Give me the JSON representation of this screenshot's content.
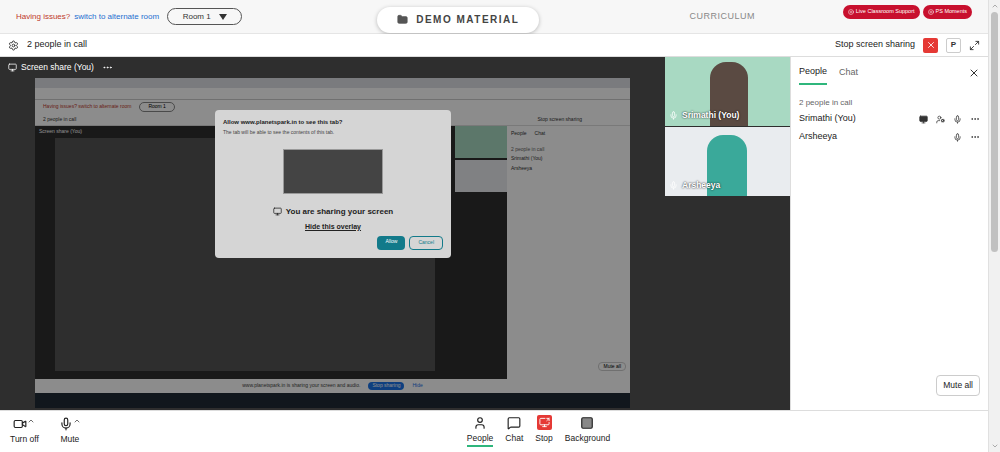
{
  "top_bar": {
    "issue_text": "Having issues?",
    "switch_link": "switch to alternate room",
    "room_select": "Room 1",
    "tabs": [
      {
        "label": "DEMO MATERIAL",
        "selected": true
      },
      {
        "label": "CURRICULUM",
        "selected": false
      }
    ],
    "buttons": [
      "Live Classroom Support",
      "PS Moments"
    ]
  },
  "call_bar": {
    "count": "2 people in call",
    "stop_label": "Stop screen sharing",
    "presenter_badge": "P"
  },
  "screen_share": {
    "label": "Screen share (You)",
    "shared": {
      "dialog_title": "Allow www.planetspark.in to see this tab?",
      "dialog_text": "The tab will be able to see the contents of this tab.",
      "sharing_text": "You are sharing your screen",
      "hide_overlay": "Hide this overlay",
      "allow": "Allow",
      "cancel": "Cancel",
      "issue_text": "Having issues? switch to alternate room",
      "room_select": "Room 1",
      "count": "2 people in call",
      "label": "Screen share (You)",
      "stop_label": "Stop screen sharing",
      "participants": [
        "Srimathi (You)",
        "Arsheeya"
      ],
      "panel_tabs": [
        "People",
        "Chat"
      ],
      "mute_all": "Mute all",
      "share_bar": "www.planetspark.in is sharing your screen and audio.",
      "stop_sharing": "Stop sharing",
      "hide": "Hide"
    }
  },
  "videos": [
    {
      "name": "Srimathi (You)",
      "color": "#a8d9c2"
    },
    {
      "name": "Arsheeya",
      "color": "#e9ecef"
    }
  ],
  "side_panel": {
    "tabs": [
      {
        "label": "People",
        "selected": true
      },
      {
        "label": "Chat",
        "selected": false
      }
    ],
    "count": "2 people in call",
    "participants": [
      {
        "name": "Srimathi (You)",
        "presenting": true
      },
      {
        "name": "Arsheeya",
        "presenting": false
      }
    ],
    "mute_all": "Mute all"
  },
  "toolbar": {
    "left": [
      {
        "label": "Turn off",
        "kind": "video"
      },
      {
        "label": "Mute",
        "kind": "mic"
      }
    ],
    "center": [
      {
        "label": "People",
        "kind": "people",
        "selected": true
      },
      {
        "label": "Chat",
        "kind": "chat",
        "selected": false
      },
      {
        "label": "Stop",
        "kind": "stop",
        "selected": false
      },
      {
        "label": "Background",
        "kind": "background",
        "selected": false
      }
    ]
  }
}
